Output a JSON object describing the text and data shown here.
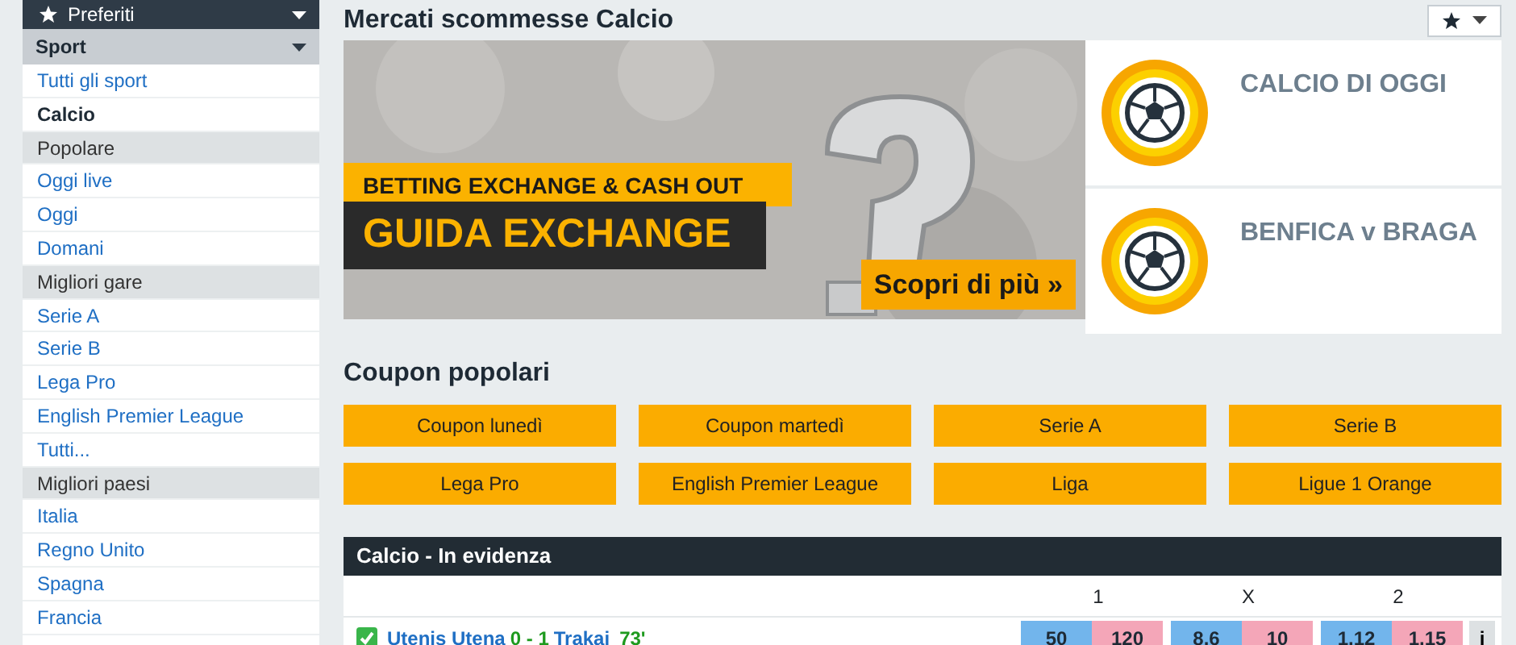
{
  "sidebar": {
    "favorites_header": "Preferiti",
    "sport_header": "Sport",
    "items": [
      {
        "kind": "link",
        "label": "Tutti gli sport"
      },
      {
        "kind": "current",
        "label": "Calcio"
      },
      {
        "kind": "group",
        "label": "Popolare"
      },
      {
        "kind": "link",
        "label": "Oggi live"
      },
      {
        "kind": "link",
        "label": "Oggi"
      },
      {
        "kind": "link",
        "label": "Domani"
      },
      {
        "kind": "group",
        "label": "Migliori gare"
      },
      {
        "kind": "link",
        "label": "Serie A"
      },
      {
        "kind": "link",
        "label": "Serie B"
      },
      {
        "kind": "link",
        "label": "Lega Pro"
      },
      {
        "kind": "link",
        "label": "English Premier League"
      },
      {
        "kind": "link",
        "label": "Tutti..."
      },
      {
        "kind": "group",
        "label": "Migliori paesi"
      },
      {
        "kind": "link",
        "label": "Italia"
      },
      {
        "kind": "link",
        "label": "Regno Unito"
      },
      {
        "kind": "link",
        "label": "Spagna"
      },
      {
        "kind": "link",
        "label": "Francia"
      }
    ]
  },
  "main": {
    "title": "Mercati scommesse Calcio",
    "banner": {
      "tag": "BETTING EXCHANGE & CASH OUT",
      "headline": "GUIDA EXCHANGE",
      "cta": "Scopri di più »"
    },
    "promo_cards": [
      {
        "title": "CALCIO DI OGGI"
      },
      {
        "title": "BENFICA v BRAGA"
      }
    ],
    "coupons": {
      "title": "Coupon popolari",
      "buttons": [
        "Coupon lunedì",
        "Coupon martedì",
        "Serie A",
        "Serie B",
        "Lega Pro",
        "English Premier League",
        "Liga",
        "Ligue 1 Orange"
      ]
    },
    "featured": {
      "title": "Calcio - In evidenza",
      "columns": [
        "1",
        "X",
        "2"
      ],
      "matches": [
        {
          "live": true,
          "home": "Utenis Utena",
          "score": "0 - 1",
          "away": "Trakai",
          "time": "73'",
          "odds": [
            {
              "back": "50",
              "lay": "120"
            },
            {
              "back": "8.6",
              "lay": "10"
            },
            {
              "back": "1.12",
              "lay": "1.15"
            }
          ],
          "info": "i"
        }
      ]
    }
  }
}
